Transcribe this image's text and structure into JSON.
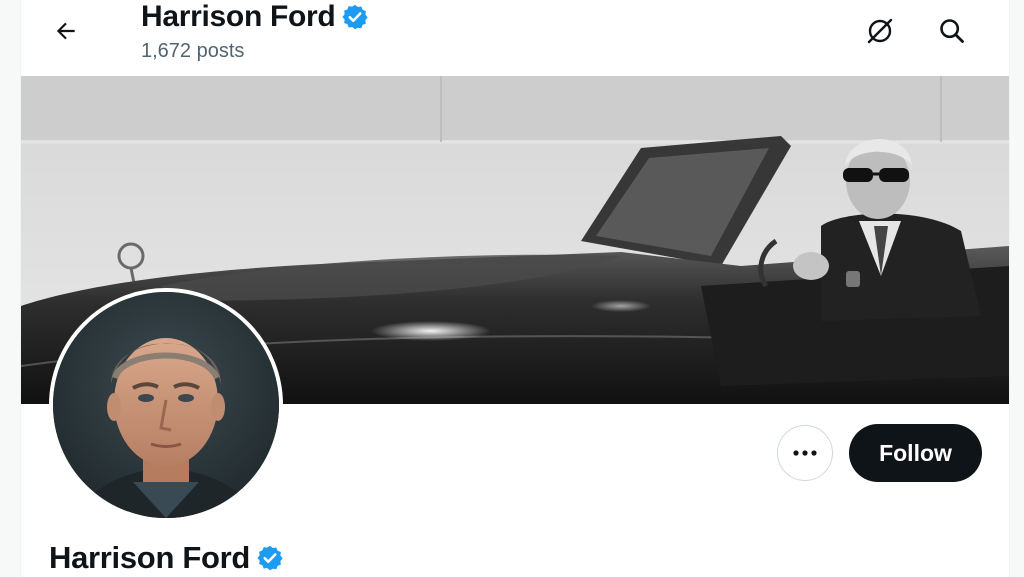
{
  "header": {
    "name": "Harrison Ford",
    "posts": "1,672 posts",
    "back_icon": "arrow-left-icon",
    "grok_icon": "grok-icon",
    "search_icon": "search-icon"
  },
  "profile": {
    "name": "Harrison Ford",
    "verified": true,
    "follow_label": "Follow",
    "more_icon": "more-dots-icon"
  },
  "colors": {
    "verified_blue": "#1d9bf0",
    "button_dark": "#0f1419",
    "secondary_text": "#536471"
  }
}
